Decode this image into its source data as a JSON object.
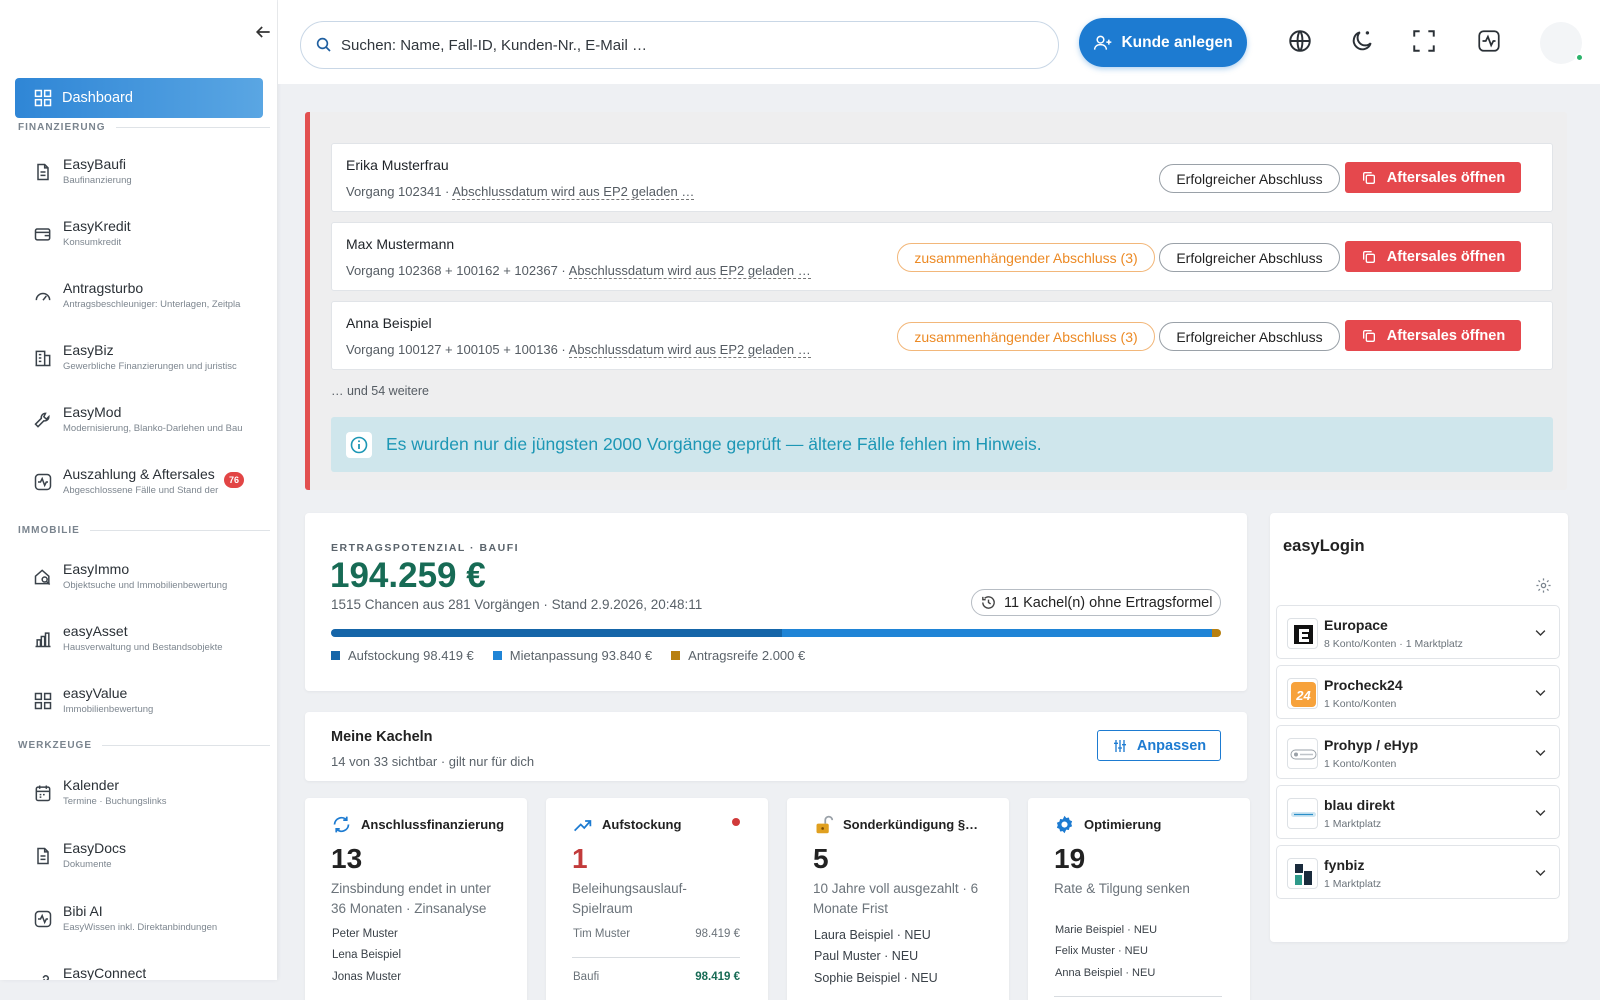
{
  "sidebar": {
    "dashboard_label": "Dashboard",
    "sections": {
      "finanzierung": "FINANZIERUNG",
      "immobilie": "IMMOBILIE",
      "werkzeuge": "WERKZEUGE"
    },
    "items": [
      {
        "label": "EasyBaufi",
        "sub": "Baufinanzierung",
        "icon": "document-icon"
      },
      {
        "label": "EasyKredit",
        "sub": "Konsumkredit",
        "icon": "wallet-icon"
      },
      {
        "label": "Antragsturbo",
        "sub": "Antragsbeschleuniger: Unterlagen, Zeitpla",
        "icon": "gauge-icon"
      },
      {
        "label": "EasyBiz",
        "sub": "Gewerbliche Finanzierungen und juristisc",
        "icon": "building-icon"
      },
      {
        "label": "EasyMod",
        "sub": "Modernisierung, Blanko-Darlehen und Bau",
        "icon": "wrench-icon"
      },
      {
        "label": "Auszahlung & Aftersales",
        "sub": "Abgeschlossene Fälle und Stand der",
        "icon": "activity-icon",
        "badge": "76"
      },
      {
        "label": "EasyImmo",
        "sub": "Objektsuche und Immobilienbewertung",
        "icon": "house-search-icon"
      },
      {
        "label": "easyAsset",
        "sub": "Hausverwaltung und Bestandsobjekte",
        "icon": "chart-building-icon"
      },
      {
        "label": "easyValue",
        "sub": "Immobilienbewertung",
        "icon": "grid-icon"
      },
      {
        "label": "Kalender",
        "sub": "Termine · Buchungslinks",
        "icon": "calendar-icon"
      },
      {
        "label": "EasyDocs",
        "sub": "Dokumente",
        "icon": "document-icon"
      },
      {
        "label": "Bibi AI",
        "sub": "EasyWissen inkl. Direktanbindungen",
        "icon": "activity-icon"
      },
      {
        "label": "EasyConnect",
        "sub": "",
        "icon": "link-icon"
      }
    ]
  },
  "topbar": {
    "search_placeholder": "Suchen: Name, Fall-ID, Kunden-Nr., E-Mail …",
    "kunde_button": "Kunde anlegen"
  },
  "alert": {
    "rows": [
      {
        "name": "Erika Musterfrau",
        "vorgang": "Vorgang 102341 · ",
        "datum": "Abschlussdatum wird aus EP2 geladen …",
        "zusammen": "",
        "status": "Erfolgreicher Abschluss",
        "action": "Aftersales öffnen"
      },
      {
        "name": "Max Mustermann",
        "vorgang": "Vorgang 102368 + 100162 + 102367 · ",
        "datum": "Abschlussdatum wird aus EP2 geladen …",
        "zusammen": "zusammenhängender Abschluss (3)",
        "status": "Erfolgreicher Abschluss",
        "action": "Aftersales öffnen"
      },
      {
        "name": "Anna Beispiel",
        "vorgang": "Vorgang 100127 + 100105 + 100136 · ",
        "datum": "Abschlussdatum wird aus EP2 geladen …",
        "zusammen": "zusammenhängender Abschluss (3)",
        "status": "Erfolgreicher Abschluss",
        "action": "Aftersales öffnen"
      }
    ],
    "more": "… und 54 weitere",
    "info": "Es wurden nur die jüngsten 2000 Vorgänge geprüft — ältere Fälle fehlen im Hinweis."
  },
  "ertrag": {
    "label": "ERTRAGSPOTENZIAL · BAUFI",
    "value": "194.259 €",
    "sub": "1515 Chancen aus 281 Vorgängen · Stand 2.9.2026, 20:48:11",
    "kachel_button": "11 Kachel(n) ohne Ertragsformel",
    "segments": [
      {
        "label": "Aufstockung 98.419 €",
        "amount": 98419,
        "color": "#1565a8"
      },
      {
        "label": "Mietanpassung 93.840 €",
        "amount": 93840,
        "color": "#1f84d6"
      },
      {
        "label": "Antragsreife 2.000 €",
        "amount": 2000,
        "color": "#b88010"
      }
    ]
  },
  "meine_kacheln": {
    "title": "Meine Kacheln",
    "sub": "14 von 33 sichtbar · gilt nur für dich",
    "button": "Anpassen"
  },
  "tiles": [
    {
      "title": "Anschlussfinanzierung",
      "icon": "refresh-icon",
      "count": "13",
      "desc": "Zinsbindung endet in unter 36 Monaten · Zinsanalyse",
      "people": [
        "Peter Muster",
        "Lena Beispiel",
        "Jonas Muster"
      ],
      "color": "#1d7bd1"
    },
    {
      "title": "Aufstockung",
      "icon": "trend-up-icon",
      "count": "1",
      "desc": "Beleihungsauslauf-Spielraum",
      "people": [
        "Tim Muster"
      ],
      "amount": "98.419 €",
      "footer_label": "Baufi",
      "footer_value": "98.419 €",
      "color": "#1d7bd1"
    },
    {
      "title": "Sonderkündigung §…",
      "icon": "unlock-icon",
      "count": "5",
      "desc": "10 Jahre voll ausgezahlt · 6 Monate Frist",
      "people": [
        "Laura Beispiel · NEU",
        "Paul Muster · NEU",
        "Sophie Beispiel · NEU"
      ],
      "color": "#e0a020"
    },
    {
      "title": "Optimierung",
      "icon": "gear-icon",
      "count": "19",
      "desc": "Rate & Tilgung senken",
      "people": [
        "Marie Beispiel · NEU",
        "Felix Muster · NEU",
        "Anna Beispiel · NEU"
      ],
      "color": "#1d7bd1"
    }
  ],
  "easylogin": {
    "title": "easyLogin",
    "items": [
      {
        "name": "Europace",
        "meta": "8 Konto/Konten · 1 Marktplatz"
      },
      {
        "name": "Procheck24",
        "meta": "1 Konto/Konten"
      },
      {
        "name": "Prohyp / eHyp",
        "meta": "1 Konto/Konten"
      },
      {
        "name": "blau direkt",
        "meta": "1 Marktplatz"
      },
      {
        "name": "fynbiz",
        "meta": "1 Marktplatz"
      }
    ]
  },
  "colors": {
    "primary": "#1d7bd1",
    "danger": "#e5484d",
    "success": "#176b55",
    "warning": "#ec8a25"
  }
}
